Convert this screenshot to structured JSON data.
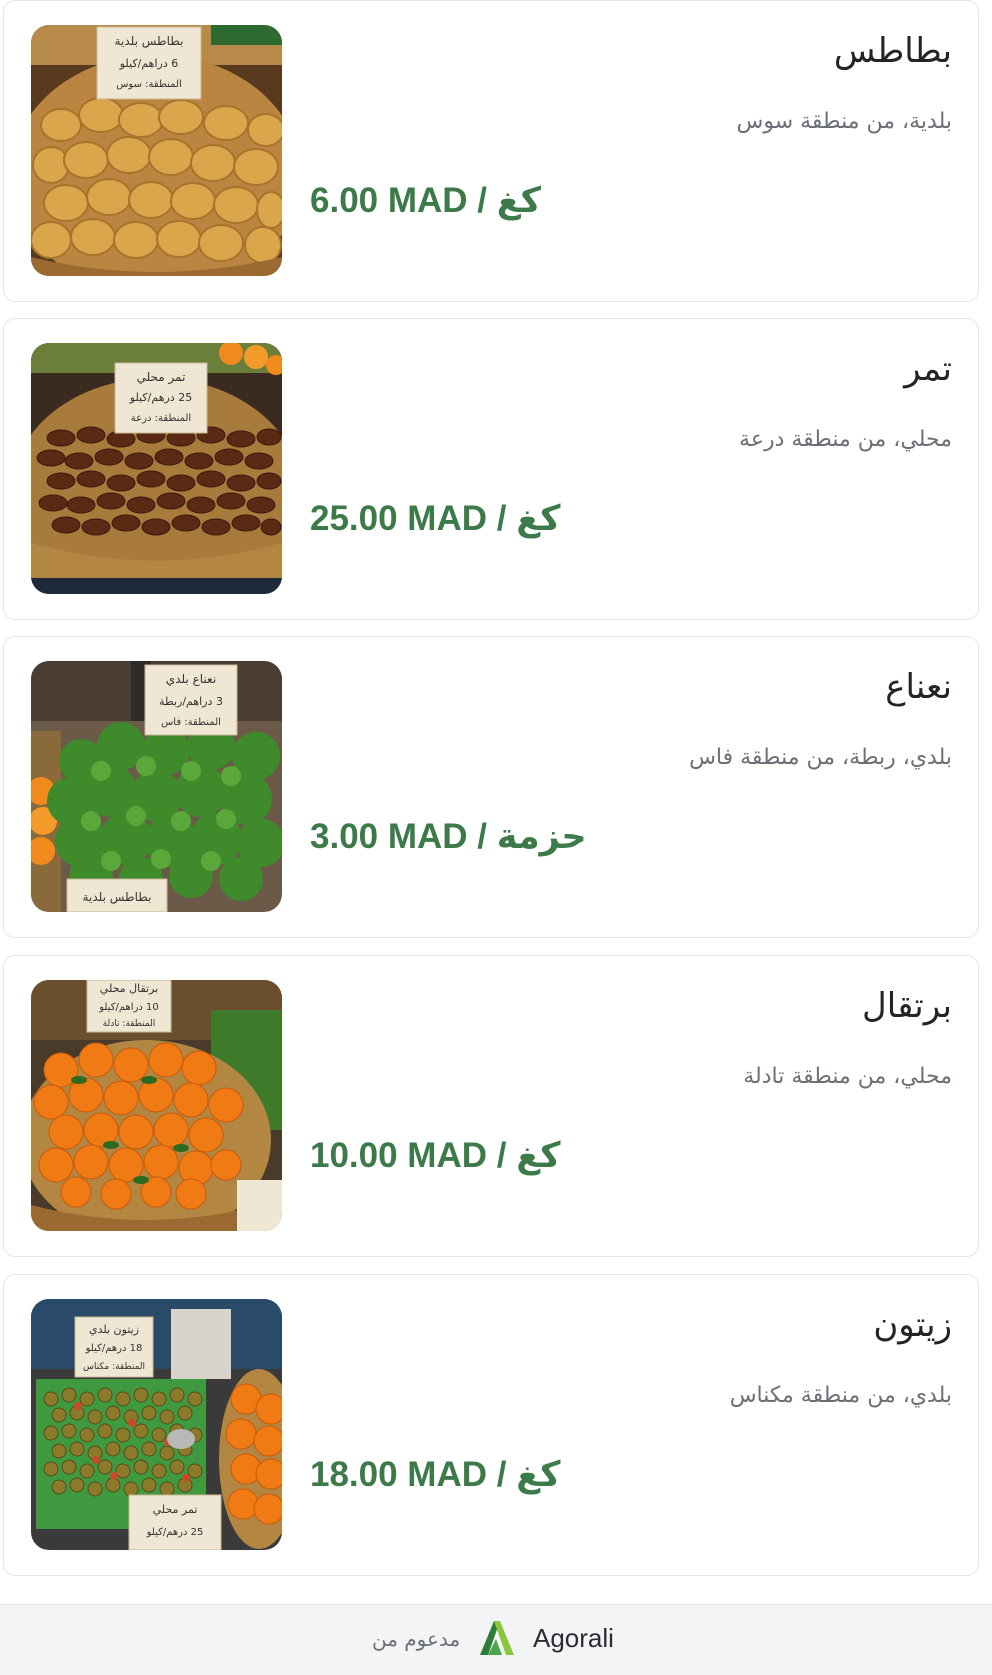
{
  "products": [
    {
      "name": "بطاطس",
      "description": "بلدية، من منطقة سوس",
      "price": "6.00 MAD",
      "unit": "كغ",
      "image": "potatoes-basket",
      "sign_lines": [
        "بطاطس بلدية",
        "6 دراهم/كيلو",
        "المنطقة: سوس"
      ]
    },
    {
      "name": "تمر",
      "description": "محلي، من منطقة درعة",
      "price": "25.00 MAD",
      "unit": "كغ",
      "image": "dates-basket",
      "sign_lines": [
        "تمر محلي",
        "25 درهم/كيلو",
        "المنطقة: درعة"
      ]
    },
    {
      "name": "نعناع",
      "description": "بلدي، ربطة، من منطقة فاس",
      "price": "3.00 MAD",
      "unit": "حزمة",
      "image": "mint-bunch",
      "sign_lines": [
        "نعناع بلدي",
        "3 دراهم/ربطة",
        "المنطقة: فاس"
      ],
      "bottom_sign": "بطاطس بلدية"
    },
    {
      "name": "برتقال",
      "description": "محلي، من منطقة تادلة",
      "price": "10.00 MAD",
      "unit": "كغ",
      "image": "oranges-basket",
      "sign_lines": [
        "برتقال محلي",
        "10 دراهم/كيلو",
        "المنطقة: تادلة"
      ]
    },
    {
      "name": "زيتون",
      "description": "بلدي، من منطقة مكناس",
      "price": "18.00 MAD",
      "unit": "كغ",
      "image": "olives-basket",
      "sign_lines": [
        "زيتون بلدي",
        "18 درهم/كيلو",
        "المنطقة: مكناس"
      ],
      "bottom_sign_lines": [
        "تمر محلي",
        "25 درهم/كيلو"
      ]
    }
  ],
  "footer": {
    "powered_by": "مدعوم من",
    "brand": "Agorali",
    "logo_icon": "agorali-logo-icon",
    "logo_colors": [
      "#2f7d3a",
      "#8cc63f"
    ]
  },
  "colors": {
    "price": "#3d7a4a",
    "title": "#222428",
    "description": "#6b6f76",
    "card_border": "#e3e6ea",
    "footer_bg": "#f3f4f6"
  }
}
